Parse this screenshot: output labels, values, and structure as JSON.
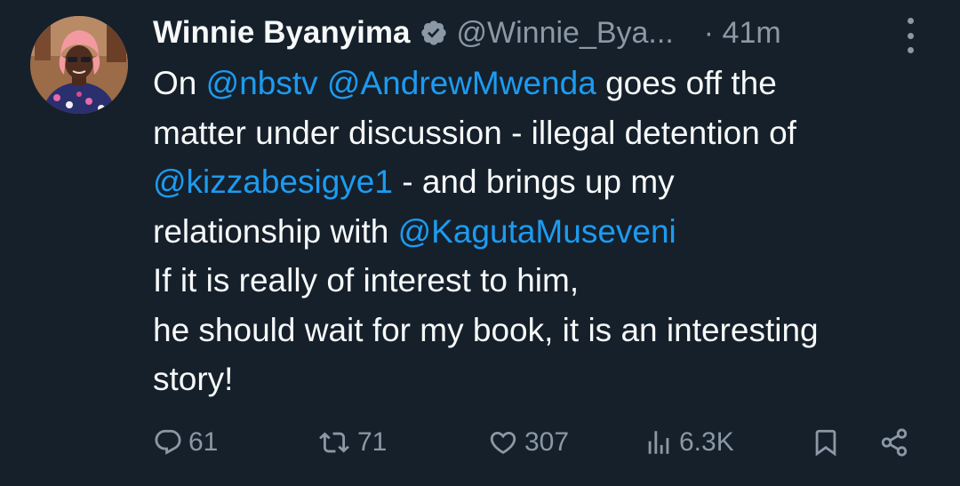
{
  "author": {
    "display_name": "Winnie Byanyima",
    "handle": "@Winnie_Bya...",
    "time": "· 41m"
  },
  "tweet": {
    "lines": [
      [
        {
          "text": "On ",
          "type": "text"
        },
        {
          "text": "@nbstv",
          "type": "mention"
        },
        {
          "text": " ",
          "type": "text"
        },
        {
          "text": "@AndrewMwenda",
          "type": "mention"
        },
        {
          "text": " goes off the",
          "type": "text"
        }
      ],
      [
        {
          "text": "matter under discussion - illegal detention of",
          "type": "text"
        }
      ],
      [
        {
          "text": "@kizzabesigye1",
          "type": "mention"
        },
        {
          "text": " - and brings up my",
          "type": "text"
        }
      ],
      [
        {
          "text": "relationship with ",
          "type": "text"
        },
        {
          "text": "@KagutaMuseveni",
          "type": "mention"
        }
      ],
      [
        {
          "text": "If it is really of interest to him,",
          "type": "text"
        }
      ],
      [
        {
          "text": "he should wait for my book, it is an interesting",
          "type": "text"
        }
      ],
      [
        {
          "text": "story!",
          "type": "text"
        }
      ]
    ]
  },
  "stats": {
    "replies": "61",
    "retweets": "71",
    "likes": "307",
    "views": "6.3K"
  },
  "icons": {
    "verified": "verified-badge-icon",
    "more": "more-options-icon",
    "reply": "reply-icon",
    "retweet": "retweet-icon",
    "like": "heart-icon",
    "views": "views-icon",
    "bookmark": "bookmark-icon",
    "share": "share-icon"
  },
  "colors": {
    "background": "#15202b",
    "text": "#f7f9f9",
    "secondary": "#8b98a5",
    "link": "#1d9bf0"
  }
}
